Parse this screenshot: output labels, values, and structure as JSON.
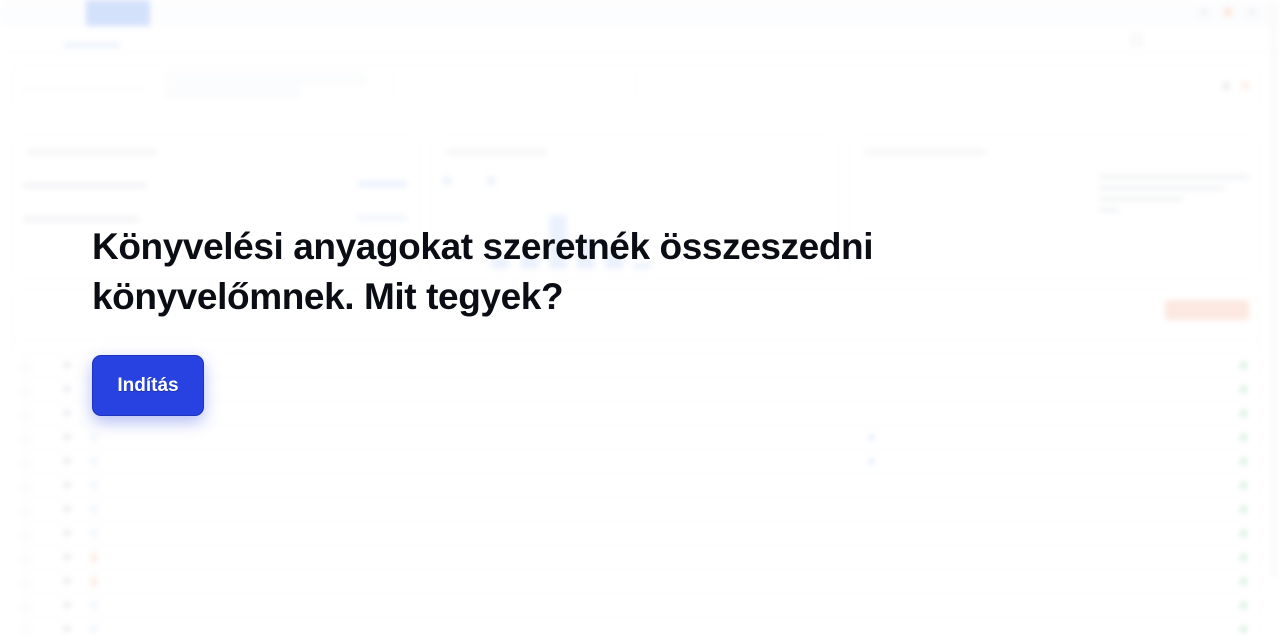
{
  "overlay": {
    "headline": "Könyvelési anyagokat szeretnék összeszedni könyvelőmnek. Mit tegyek?",
    "start_button": "Indítás"
  },
  "colors": {
    "button_primary": "#2742e0",
    "accent_blue": "#3f7cf0",
    "accent_orange": "#f39a7a",
    "status_green": "#39b36b",
    "headline_text": "#0b0d14"
  }
}
